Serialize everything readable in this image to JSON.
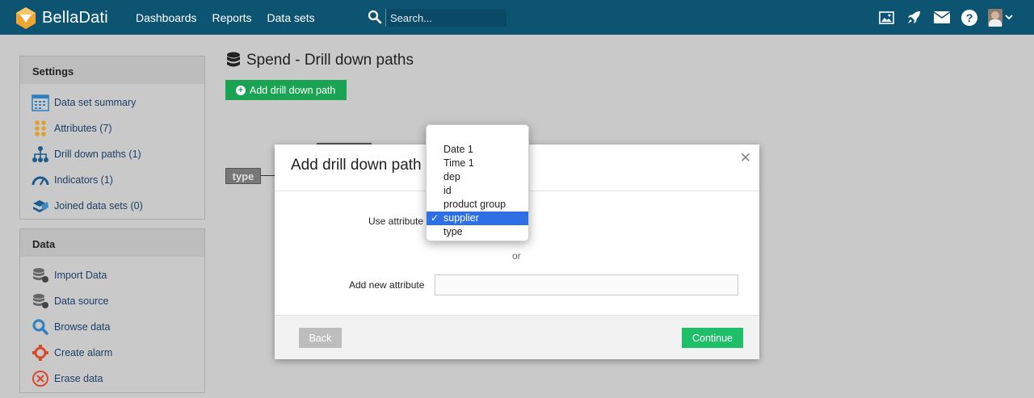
{
  "app": {
    "name": "BellaDati"
  },
  "nav": {
    "dashboards": "Dashboards",
    "reports": "Reports",
    "datasets": "Data sets"
  },
  "search": {
    "placeholder": "Search..."
  },
  "sidebar": {
    "settings_title": "Settings",
    "settings_items": [
      {
        "label": "Data set summary",
        "icon": "calendar-icon"
      },
      {
        "label": "Attributes (7)",
        "icon": "attributes-dots-icon"
      },
      {
        "label": "Drill down paths (1)",
        "icon": "hierarchy-icon"
      },
      {
        "label": "Indicators (1)",
        "icon": "gauge-icon"
      },
      {
        "label": "Joined data sets (0)",
        "icon": "joined-datasets-icon"
      }
    ],
    "data_title": "Data",
    "data_items": [
      {
        "label": "Import Data",
        "icon": "database-icon"
      },
      {
        "label": "Data source",
        "icon": "database-icon"
      },
      {
        "label": "Browse data",
        "icon": "magnifier-icon"
      },
      {
        "label": "Create alarm",
        "icon": "alarm-icon"
      },
      {
        "label": "Erase data",
        "icon": "erase-icon"
      }
    ]
  },
  "main": {
    "title": "Spend - Drill down paths",
    "add_button": "Add drill down path",
    "node_label": "type"
  },
  "modal": {
    "title": "Add drill down path",
    "use_attribute_label": "Use attribute",
    "or_label": "or",
    "new_attribute_label": "Add new attribute",
    "new_attribute_value": "",
    "back_label": "Back",
    "continue_label": "Continue"
  },
  "dropdown": {
    "options": [
      "Date 1",
      "Time 1",
      "dep",
      "id",
      "product group",
      "supplier",
      "type"
    ],
    "selected": "supplier"
  },
  "colors": {
    "topbar": "#0d5473",
    "accent_green": "#1aa352",
    "continue_green": "#1fbf6a",
    "selection_blue": "#2f6fe6"
  }
}
